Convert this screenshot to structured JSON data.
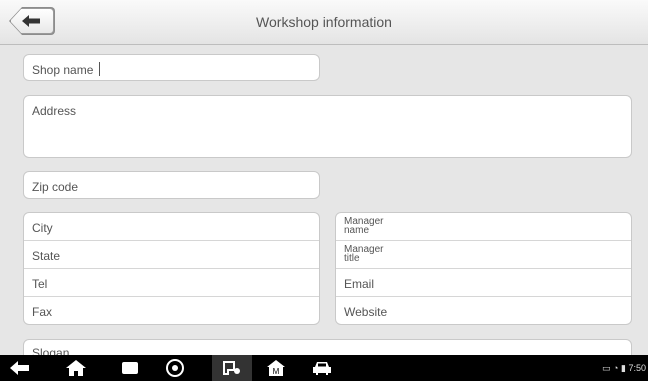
{
  "header": {
    "title": "Workshop information"
  },
  "form": {
    "shop_name": "Shop name",
    "address": "Address",
    "zip_code": "Zip code",
    "left_group": [
      "City",
      "State",
      "Tel",
      "Fax"
    ],
    "right_group": [
      "Manager\nname",
      "Manager\ntitle",
      "Email",
      "Website"
    ],
    "slogan": "Slogan"
  },
  "status": {
    "time": "7:50"
  },
  "icons": {
    "back": "back-arrow-icon",
    "nav": [
      "nav-back-icon",
      "home-icon",
      "recent-apps-icon",
      "chrome-icon",
      "vci-connect-icon",
      "shop-home-icon",
      "car-icon"
    ]
  }
}
